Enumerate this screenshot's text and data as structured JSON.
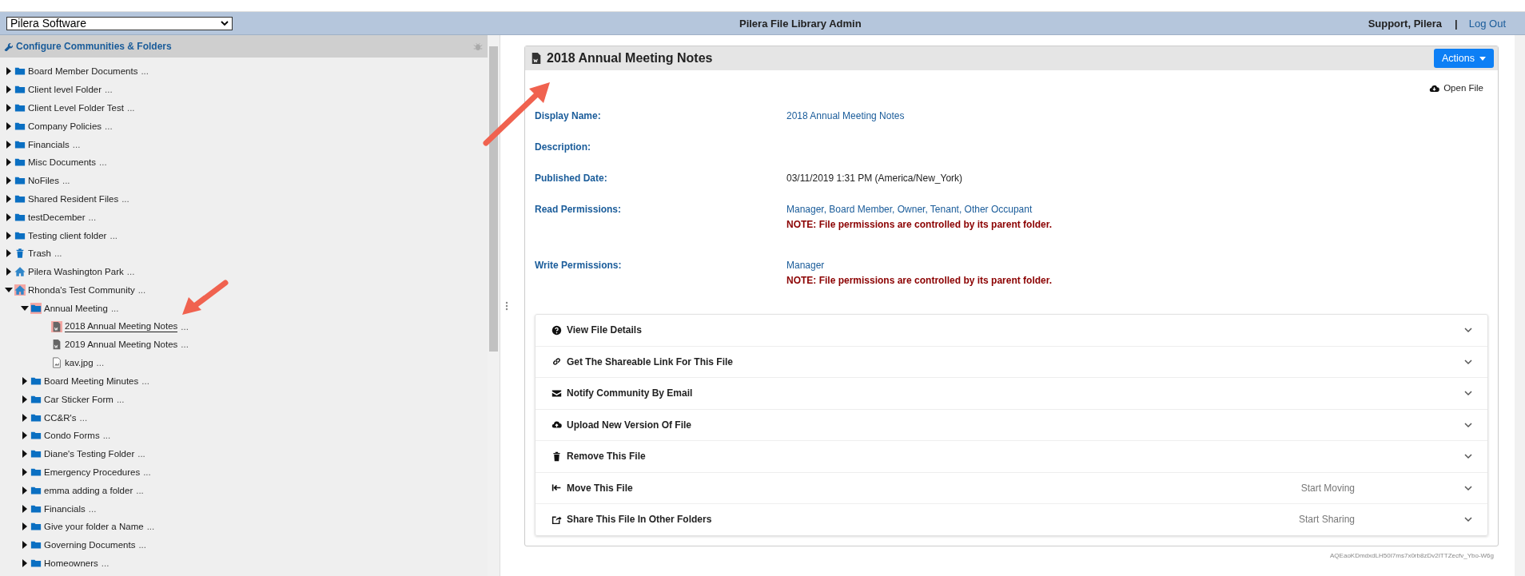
{
  "header": {
    "org_select": "Pilera Software",
    "title": "Pilera File Library Admin",
    "user": "Support, Pilera",
    "separator": "|",
    "logout": "Log Out"
  },
  "sidebar": {
    "title": "Configure Communities & Folders",
    "tree": [
      {
        "kind": "folder",
        "label": "Board Member Documents",
        "more": "...",
        "expanded": false,
        "selected": false,
        "marked": false
      },
      {
        "kind": "folder",
        "label": "Client level Folder",
        "more": "...",
        "expanded": false,
        "selected": false,
        "marked": false
      },
      {
        "kind": "folder",
        "label": "Client Level Folder Test",
        "more": "...",
        "expanded": false,
        "selected": false,
        "marked": false
      },
      {
        "kind": "folder",
        "label": "Company Policies",
        "more": "...",
        "expanded": false,
        "selected": false,
        "marked": false
      },
      {
        "kind": "folder",
        "label": "Financials",
        "more": "...",
        "expanded": false,
        "selected": false,
        "marked": false
      },
      {
        "kind": "folder",
        "label": "Misc Documents",
        "more": "...",
        "expanded": false,
        "selected": false,
        "marked": false
      },
      {
        "kind": "folder",
        "label": "NoFiles",
        "more": "...",
        "expanded": false,
        "selected": false,
        "marked": false
      },
      {
        "kind": "folder",
        "label": "Shared Resident Files",
        "more": "...",
        "expanded": false,
        "selected": false,
        "marked": false
      },
      {
        "kind": "folder",
        "label": "testDecember",
        "more": "...",
        "expanded": false,
        "selected": false,
        "marked": false
      },
      {
        "kind": "folder",
        "label": "Testing client folder",
        "more": "...",
        "expanded": false,
        "selected": false,
        "marked": false
      },
      {
        "kind": "trash",
        "label": "Trash",
        "more": "...",
        "expanded": false,
        "selected": false,
        "marked": false
      },
      {
        "kind": "community",
        "label": "Pilera Washington Park",
        "more": "...",
        "expanded": false,
        "selected": false,
        "marked": false
      },
      {
        "kind": "community",
        "label": "Rhonda's Test Community",
        "more": "...",
        "expanded": true,
        "selected": false,
        "marked": true,
        "children": [
          {
            "kind": "folder",
            "label": "Annual Meeting",
            "more": "...",
            "expanded": true,
            "selected": false,
            "marked": true,
            "children": [
              {
                "kind": "word-file",
                "label": "2018 Annual Meeting Notes",
                "more": "...",
                "selected": true,
                "marked": true
              },
              {
                "kind": "word-file",
                "label": "2019 Annual Meeting Notes",
                "more": "...",
                "selected": false,
                "marked": false
              },
              {
                "kind": "image-file",
                "label": "kav.jpg",
                "more": "...",
                "selected": false,
                "marked": false
              }
            ]
          },
          {
            "kind": "folder",
            "label": "Board Meeting Minutes",
            "more": "...",
            "expanded": false,
            "selected": false,
            "marked": false
          },
          {
            "kind": "folder",
            "label": "Car Sticker Form",
            "more": "...",
            "expanded": false,
            "selected": false,
            "marked": false
          },
          {
            "kind": "folder",
            "label": "CC&R's",
            "more": "...",
            "expanded": false,
            "selected": false,
            "marked": false
          },
          {
            "kind": "folder",
            "label": "Condo Forms",
            "more": "...",
            "expanded": false,
            "selected": false,
            "marked": false
          },
          {
            "kind": "folder",
            "label": "Diane's Testing Folder",
            "more": "...",
            "expanded": false,
            "selected": false,
            "marked": false
          },
          {
            "kind": "folder",
            "label": "Emergency Procedures",
            "more": "...",
            "expanded": false,
            "selected": false,
            "marked": false
          },
          {
            "kind": "folder",
            "label": "emma adding a folder",
            "more": "...",
            "expanded": false,
            "selected": false,
            "marked": false
          },
          {
            "kind": "folder",
            "label": "Financials",
            "more": "...",
            "expanded": false,
            "selected": false,
            "marked": false
          },
          {
            "kind": "folder",
            "label": "Give your folder a Name",
            "more": "...",
            "expanded": false,
            "selected": false,
            "marked": false
          },
          {
            "kind": "folder",
            "label": "Governing Documents",
            "more": "...",
            "expanded": false,
            "selected": false,
            "marked": false
          },
          {
            "kind": "folder",
            "label": "Homeowners",
            "more": "...",
            "expanded": false,
            "selected": false,
            "marked": false
          }
        ]
      }
    ]
  },
  "file": {
    "title": "2018 Annual Meeting Notes",
    "actions_button": "Actions",
    "open_file": "Open File",
    "details": [
      {
        "label": "Display Name:",
        "values": [
          "2018 Annual Meeting Notes"
        ],
        "plain": false
      },
      {
        "label": "Description:"
      },
      {
        "label": "Published Date:",
        "values": [
          "03/11/2019 1:31 PM (America/New_York)"
        ],
        "plain": true
      },
      {
        "label": "Read Permissions:",
        "values": [
          "Manager, Board Member, Owner, Tenant, Other Occupant"
        ],
        "plain": false,
        "note": "NOTE: File permissions are controlled by its parent folder."
      },
      {
        "label": "Write Permissions:",
        "values": [
          "Manager"
        ],
        "plain": false,
        "note": "NOTE: File permissions are controlled by its parent folder."
      }
    ],
    "sections": [
      {
        "kind": "question",
        "label": "View File Details"
      },
      {
        "kind": "link",
        "label": "Get The Shareable Link For This File"
      },
      {
        "kind": "envelope",
        "label": "Notify Community By Email"
      },
      {
        "kind": "upload",
        "label": "Upload New Version Of File"
      },
      {
        "kind": "remove",
        "label": "Remove This File"
      },
      {
        "kind": "move",
        "label": "Move This File",
        "action": "Start Moving"
      },
      {
        "kind": "share",
        "label": "Share This File In Other Folders",
        "action": "Start Sharing"
      }
    ],
    "file_id": "AQEaoKDmdxdLH50I7ms7x0rb8zDv2ITTZecfv_Ybo-W6g"
  }
}
